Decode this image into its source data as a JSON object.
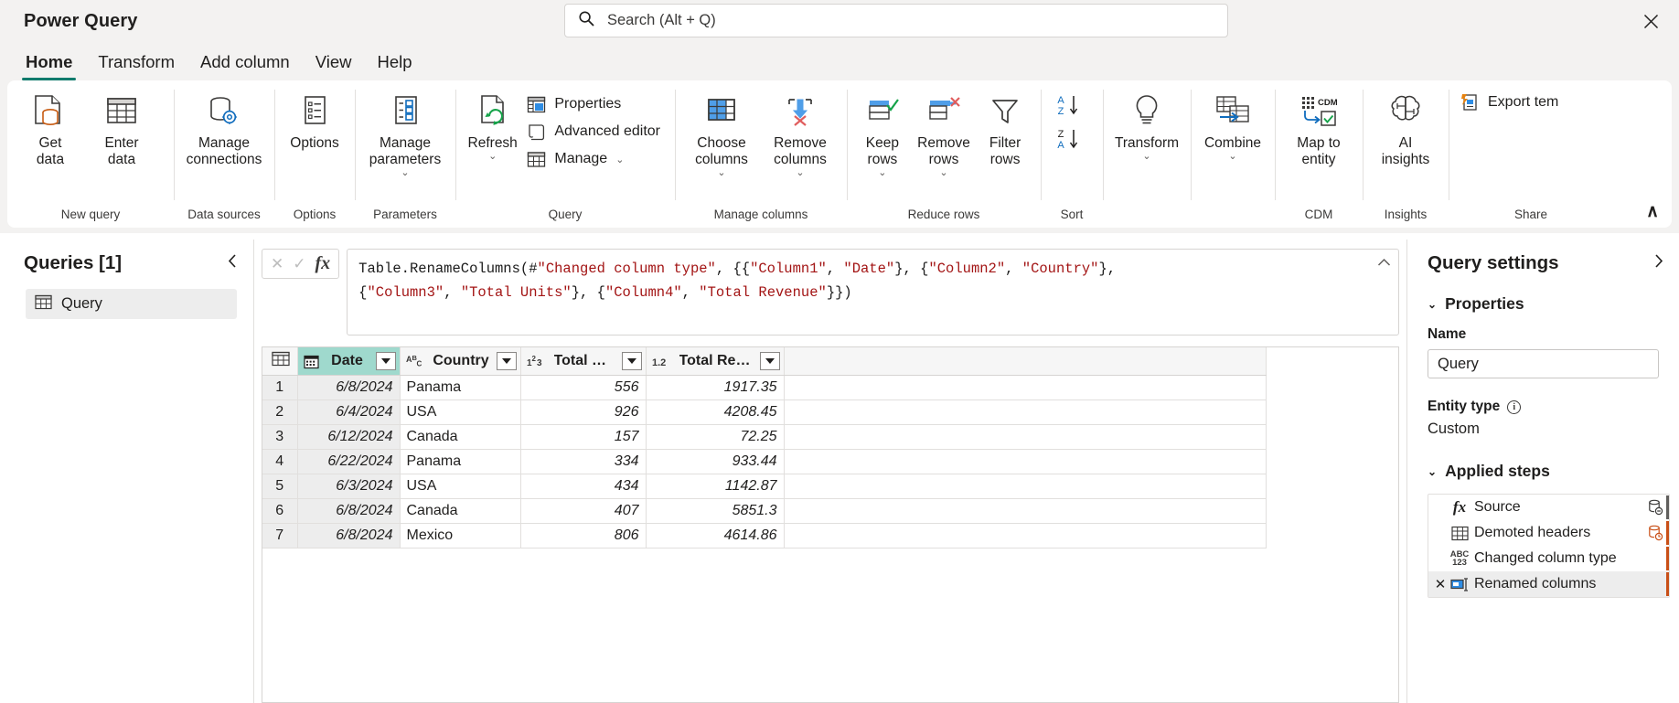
{
  "app": {
    "title": "Power Query",
    "close_label": "✕"
  },
  "search": {
    "placeholder": "Search (Alt + Q)",
    "icon": "search-icon"
  },
  "tabs": [
    {
      "label": "Home",
      "active": true
    },
    {
      "label": "Transform",
      "active": false
    },
    {
      "label": "Add column",
      "active": false
    },
    {
      "label": "View",
      "active": false
    },
    {
      "label": "Help",
      "active": false
    }
  ],
  "ribbon": {
    "groups": [
      {
        "name": "New query",
        "label": "New query"
      },
      {
        "name": "Data sources",
        "label": "Data sources"
      },
      {
        "name": "Options",
        "label": "Options"
      },
      {
        "name": "Parameters",
        "label": "Parameters"
      },
      {
        "name": "Query",
        "label": "Query"
      },
      {
        "name": "Manage columns",
        "label": "Manage columns"
      },
      {
        "name": "Reduce rows",
        "label": "Reduce rows"
      },
      {
        "name": "Sort",
        "label": "Sort"
      },
      {
        "name": "CDM",
        "label": "CDM"
      },
      {
        "name": "Insights",
        "label": "Insights"
      },
      {
        "name": "Share",
        "label": "Share"
      }
    ],
    "buttons": {
      "get_data": "Get\ndata",
      "enter_data": "Enter\ndata",
      "manage_connections": "Manage\nconnections",
      "options": "Options",
      "manage_parameters": "Manage\nparameters",
      "refresh": "Refresh",
      "properties": "Properties",
      "advanced_editor": "Advanced editor",
      "manage": "Manage",
      "choose_columns": "Choose\ncolumns",
      "remove_columns": "Remove\ncolumns",
      "keep_rows": "Keep\nrows",
      "remove_rows": "Remove\nrows",
      "filter_rows": "Filter\nrows",
      "sort_asc": "A–Z sort ascending",
      "sort_desc": "Z–A sort descending",
      "transform": "Transform",
      "combine": "Combine",
      "map_to_entity": "Map to\nentity",
      "ai_insights": "AI\ninsights",
      "export_template": "Export tem",
      "collapse_ribbon": "∧"
    }
  },
  "queries_pane": {
    "title": "Queries [1]",
    "collapse_icon": "chevron-left-icon",
    "items": [
      {
        "label": "Query",
        "icon": "table-icon",
        "selected": true
      }
    ]
  },
  "formula_bar": {
    "cancel_icon": "✕",
    "accept_icon": "✓",
    "fx_label": "fx",
    "expand_icon": "⌃",
    "formula_segments": [
      {
        "t": "Table.RenameColumns(#",
        "s": false
      },
      {
        "t": "\"Changed column type\"",
        "s": true
      },
      {
        "t": ", {{",
        "s": false
      },
      {
        "t": "\"Column1\"",
        "s": true
      },
      {
        "t": ", ",
        "s": false
      },
      {
        "t": "\"Date\"",
        "s": true
      },
      {
        "t": "}, {",
        "s": false
      },
      {
        "t": "\"Column2\"",
        "s": true
      },
      {
        "t": ", ",
        "s": false
      },
      {
        "t": "\"Country\"",
        "s": true
      },
      {
        "t": "},\n{",
        "s": false
      },
      {
        "t": "\"Column3\"",
        "s": true
      },
      {
        "t": ", ",
        "s": false
      },
      {
        "t": "\"Total Units\"",
        "s": true
      },
      {
        "t": "}, {",
        "s": false
      },
      {
        "t": "\"Column4\"",
        "s": true
      },
      {
        "t": ", ",
        "s": false
      },
      {
        "t": "\"Total Revenue\"",
        "s": true
      },
      {
        "t": "}})",
        "s": false
      }
    ]
  },
  "grid": {
    "columns": [
      {
        "name": "Date",
        "type_icon": "calendar-icon",
        "type": "date",
        "selected": true
      },
      {
        "name": "Country",
        "type_icon": "abc-icon",
        "type": "text",
        "selected": false
      },
      {
        "name": "Total Units",
        "type_icon": "whole-number-icon",
        "type": "whole number",
        "selected": false
      },
      {
        "name": "Total Revenue",
        "type_icon": "decimal-number-icon",
        "type": "decimal number",
        "selected": false
      }
    ],
    "rows": [
      {
        "n": "1",
        "date": "6/8/2024",
        "country": "Panama",
        "units": "556",
        "revenue": "1917.35"
      },
      {
        "n": "2",
        "date": "6/4/2024",
        "country": "USA",
        "units": "926",
        "revenue": "4208.45"
      },
      {
        "n": "3",
        "date": "6/12/2024",
        "country": "Canada",
        "units": "157",
        "revenue": "72.25"
      },
      {
        "n": "4",
        "date": "6/22/2024",
        "country": "Panama",
        "units": "334",
        "revenue": "933.44"
      },
      {
        "n": "5",
        "date": "6/3/2024",
        "country": "USA",
        "units": "434",
        "revenue": "1142.87"
      },
      {
        "n": "6",
        "date": "6/8/2024",
        "country": "Canada",
        "units": "407",
        "revenue": "5851.3"
      },
      {
        "n": "7",
        "date": "6/8/2024",
        "country": "Mexico",
        "units": "806",
        "revenue": "4614.86"
      }
    ]
  },
  "query_settings": {
    "title": "Query settings",
    "expand_icon": "›",
    "properties_section": "Properties",
    "name_label": "Name",
    "name_value": "Query",
    "entity_type_label": "Entity type",
    "entity_type_value": "Custom",
    "applied_steps_section": "Applied steps",
    "steps": [
      {
        "label": "Source",
        "icon": "fx-icon",
        "selected": false,
        "has_delete": false,
        "right_icon": "database-minus-icon",
        "bar_color": "#605e5c"
      },
      {
        "label": "Demoted headers",
        "icon": "table-icon",
        "selected": false,
        "has_delete": false,
        "right_icon": "database-clock-icon",
        "bar_color": "#c94f17"
      },
      {
        "label": "Changed column type",
        "icon": "abc123-icon",
        "selected": false,
        "has_delete": false,
        "right_icon": "",
        "bar_color": "#c94f17"
      },
      {
        "label": "Renamed columns",
        "icon": "rename-columns-icon",
        "selected": true,
        "has_delete": true,
        "right_icon": "",
        "bar_color": "#c94f17"
      }
    ]
  },
  "colors": {
    "accent_teal": "#107b6c",
    "selection_teal": "#9fd9cd",
    "ribbon_bg": "#f3f2f1",
    "string_red": "#a31515",
    "step_bar_orange": "#c94f17"
  }
}
